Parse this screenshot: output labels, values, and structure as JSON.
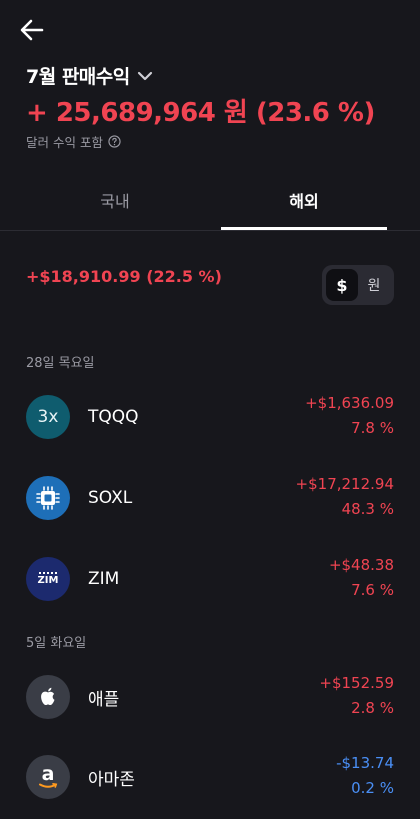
{
  "header": {
    "title": "7월 판매수익",
    "total": "+ 25,689,964 원 (23.6 %)",
    "note": "달러 수익 포함"
  },
  "tabs": [
    {
      "label": "국내",
      "active": false
    },
    {
      "label": "해외",
      "active": true
    }
  ],
  "summary": "+$18,910.99 (22.5 %)",
  "currency_toggle": {
    "usd": "$",
    "krw": "원",
    "selected": "usd"
  },
  "groups": [
    {
      "date": "28일 목요일",
      "items": [
        {
          "logo_text": "3x",
          "logo_color": "#0f5c6e",
          "icon": "leveraged-3x-icon",
          "name": "TQQQ",
          "amount": "+$1,636.09",
          "percent": "7.8 %",
          "trend": "up"
        },
        {
          "logo_text": "",
          "logo_color": "#1e6fb8",
          "icon": "chip-icon",
          "name": "SOXL",
          "amount": "+$17,212.94",
          "percent": "48.3 %",
          "trend": "up"
        },
        {
          "logo_text": "ZIM",
          "logo_color": "#1c2a6e",
          "icon": "zim-logo-icon",
          "name": "ZIM",
          "amount": "+$48.38",
          "percent": "7.6 %",
          "trend": "up"
        }
      ]
    },
    {
      "date": "5일 화요일",
      "items": [
        {
          "logo_text": "",
          "logo_color": "#3a3d46",
          "icon": "apple-icon",
          "name": "애플",
          "amount": "+$152.59",
          "percent": "2.8 %",
          "trend": "up"
        },
        {
          "logo_text": "a",
          "logo_color": "#3a3d46",
          "icon": "amazon-icon",
          "name": "아마존",
          "amount": "-$13.74",
          "percent": "0.2 %",
          "trend": "down"
        }
      ]
    }
  ],
  "colors": {
    "up": "#f04452",
    "down": "#4a8ff5",
    "background": "#17171c"
  }
}
